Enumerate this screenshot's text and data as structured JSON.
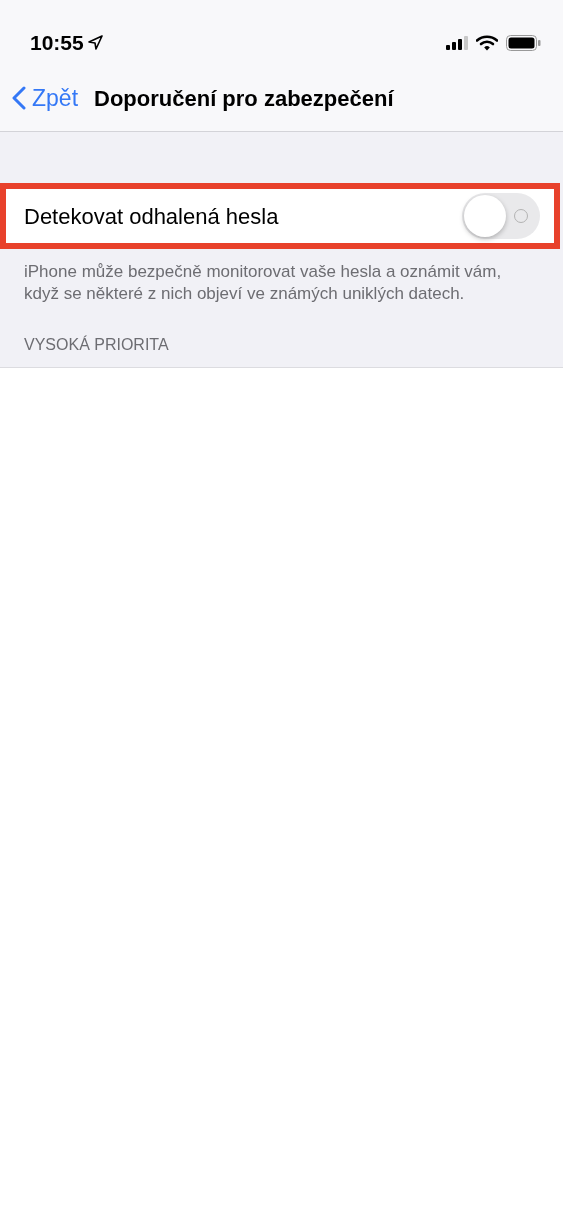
{
  "status_bar": {
    "time": "10:55"
  },
  "nav": {
    "back_label": "Zpět",
    "title": "Doporučení pro zabezpečení"
  },
  "setting": {
    "label": "Detekovat odhalená hesla",
    "on": false,
    "highlighted": true
  },
  "footer": "iPhone může bezpečně monitorovat vaše hesla a oznámit vám, když se některé z nich objeví ve známých uniklých datech.",
  "section_header": "VYSOKÁ PRIORITA"
}
